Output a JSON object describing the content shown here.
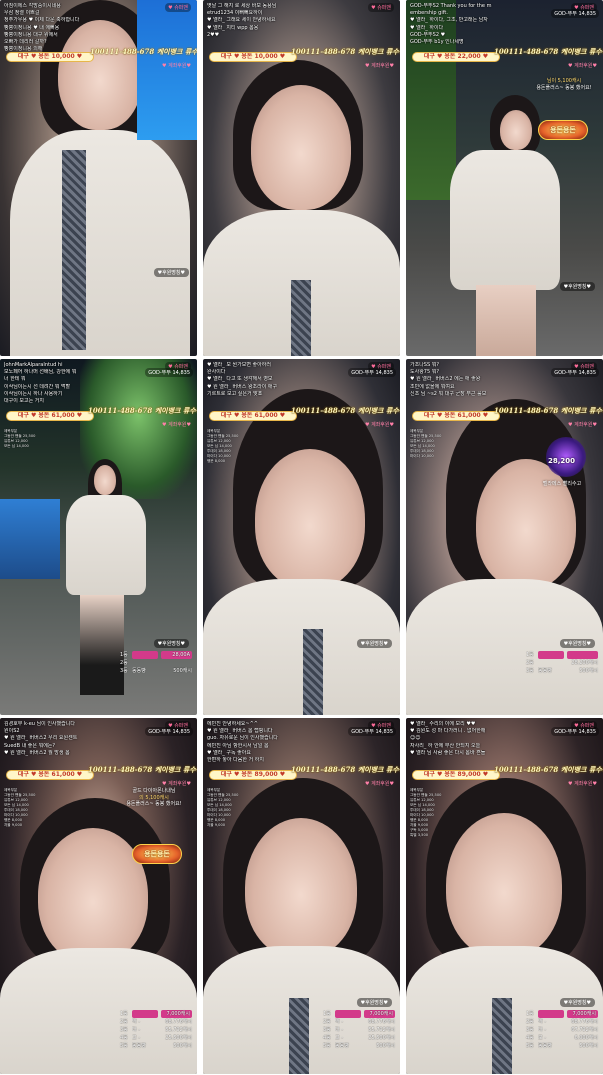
{
  "common": {
    "heart_badge": "♥ 슈퍼맨",
    "god_badge": "GOD-뚜뚜 14,835",
    "account_text": "100111-488-678 케이뱅크 류수욱",
    "rank_tag": "♥ 계좌후원♥",
    "sub_badge": "♥후원명칭♥",
    "mini_list": [
      "제목부분",
      "그동안 팬들 25,500",
      "유튜브 12,000",
      "모든 님 14,000",
      "투데이 18,000",
      "마이다 10,000",
      "행운 8,000",
      "자율 9,000",
      "구독 5,000",
      "특별 3,500",
      "기념 3,000",
      "랭킹 2,500"
    ]
  },
  "tiles": [
    {
      "goal": "대구 ♥ 용돈 10,000 ♥",
      "chat": [
        {
          "nick": "",
          "text": "아침이에스 각방중이시네용"
        },
        {
          "nick": "",
          "text": "우삼 정렬 이쁘걸"
        },
        {
          "nick": "",
          "text": "정주가우용 ♥ 이제 다운 축하합니다"
        },
        {
          "nick": "",
          "text": "빵뿡이정니용 ♥ 내 에뻐용"
        },
        {
          "nick": "",
          "text": "빵뿡이정니용 대구 위에서"
        },
        {
          "nick": "",
          "text": "오빠가 데리러 갈까?"
        },
        {
          "nick": "",
          "text": "빵뿡이정니용 의해"
        }
      ]
    },
    {
      "goal": "대구 ♥ 용돈 10,000 ♥",
      "chat": [
        {
          "nick": "",
          "text": "옛날 그 해지 로 세상 바보 동용님"
        },
        {
          "nick": "",
          "text": "etrud1234 이뻐뻐요하이"
        },
        {
          "nick": "",
          "text": "♥ 엘라_ 그래요 세이 안녕하세요"
        },
        {
          "nick": "",
          "text": "♥ 엘라_ 지티 wpp 봄용"
        },
        {
          "nick": "",
          "text": "2♥♥"
        }
      ]
    },
    {
      "goal": "대구 ♥ 용돈 22,000 ♥",
      "chat": [
        {
          "nick": "",
          "text": "GOD-뚜뚜S2 Thank you for the m"
        },
        {
          "nick": "",
          "text": "embership gift."
        },
        {
          "nick": "",
          "text": "♥ 엘라_ 하이다, 그조, 반고래는 남자"
        },
        {
          "nick": "",
          "text": "♥ 엘라_ 하이다"
        },
        {
          "nick": "",
          "text": "GOD-뚜뚜S2 ♥"
        },
        {
          "nick": "",
          "text": "GOD-뚜뚜 b1y 인나세명"
        }
      ]
    },
    {
      "goal": "대구 ♥ 용돈 61,000 ♥",
      "chat": [
        {
          "nick": "",
          "text": "JohnMarkAlparaIntud hi"
        },
        {
          "nick": "",
          "text": "모노페어 하나머 선배님, 강한에 뭐"
        },
        {
          "nick": "",
          "text": "너 한테 뭐"
        },
        {
          "nick": "",
          "text": "이삭님이는시 선 데려간 뭐 먹할"
        },
        {
          "nick": "",
          "text": "이삭님이는시 하나 사용하기"
        },
        {
          "nick": "",
          "text": "대구이 보고는 거지"
        }
      ]
    },
    {
      "goal": "대구 ♥ 용돈 61,000 ♥",
      "chat": [
        {
          "nick": "",
          "text": "♥ 엘라_ 모 뭔가보면 좋아하러"
        },
        {
          "nick": "",
          "text": "완사이다"
        },
        {
          "nick": "",
          "text": "♥ 엘라_ 다고 또 생각해서 영모"
        },
        {
          "nick": "",
          "text": "♥ 원 엘라_ 버버스 왕조라이 애구"
        },
        {
          "nick": "",
          "text": "기르트로 보고 싶은거 맞죠"
        }
      ]
    },
    {
      "goal": "대구 ♥ 용돈 61,000 ♥",
      "chat": [
        {
          "nick": "",
          "text": "가조나SS 뭐?"
        },
        {
          "nick": "",
          "text": "도사왕75 뭐?"
        },
        {
          "nick": "",
          "text": "♥ 원 엘라_ 버버스2 에는 애 좋왕"
        },
        {
          "nick": "",
          "text": "조민에 없을에 뭐여요"
        },
        {
          "nick": "",
          "text": "신조 님 ~s2 뭐 대구 군장 부근 룰보"
        }
      ]
    },
    {
      "goal": "대구 ♥ 용돈 61,000 ♥",
      "chat": [
        {
          "nick": "",
          "text": "김경호무 k-eu 님이 인사했습니다"
        },
        {
          "nick": "",
          "text": "원이S2"
        },
        {
          "nick": "",
          "text": "♥ 원 엘라_ 버버스2 우리 요원센트"
        },
        {
          "nick": "",
          "text": "SuedB 내 좋은 뭐에는?"
        },
        {
          "nick": "",
          "text": "♥ 원 엘라_ 버버스2 월 방생 봄"
        }
      ]
    },
    {
      "goal": "대구 ♥ 용돈 89,000 ♥",
      "chat": [
        {
          "nick": "",
          "text": "에빈진 안녕하세요~^^"
        },
        {
          "nick": "",
          "text": "♥ 원 엘라_ 버버스 봄 랩핑니다"
        },
        {
          "nick": "",
          "text": "guo. 자유로운 님이 인사했습니다"
        },
        {
          "nick": "",
          "text": "에빈진 아님 항한시서 남일 봄"
        },
        {
          "nick": "",
          "text": "♥ 엘라_ 구독 좋아요"
        },
        {
          "nick": "",
          "text": "한편하 놓아 다음한 거 하지"
        }
      ]
    },
    {
      "goal": "대구 ♥ 용돈 89,000 ♥",
      "chat": [
        {
          "nick": "",
          "text": "♥ 엘라_ 수리의 이에 보리 ♥♥"
        },
        {
          "nick": "",
          "text": "♥ 김원도 성 마 다가러니 . 없어한해"
        },
        {
          "nick": "",
          "text": "☺☺"
        },
        {
          "nick": "",
          "text": "자사리_ 하 안에 부산 안되지 오늘"
        },
        {
          "nick": "",
          "text": "♥ 엘라 님 사람 좋은 다시 봄바 흔들"
        }
      ]
    }
  ],
  "rankings_a": [
    {
      "pos": "1등",
      "name": "",
      "val": "28,00A"
    },
    {
      "pos": "2등",
      "name": "",
      "val": ""
    },
    {
      "pos": "3등",
      "name": "동동빵",
      "val": "500캐시"
    }
  ],
  "rankings_b": [
    {
      "pos": "1등",
      "name": "",
      "val": ""
    },
    {
      "pos": "2등",
      "name": "",
      "val": "28,200캐시"
    },
    {
      "pos": "3등",
      "name": "동동빵",
      "val": "500캐시"
    }
  ],
  "rankings_c": [
    {
      "pos": "1등",
      "name": "",
      "val": "7,000캐시"
    },
    {
      "pos": "2등",
      "name": "딱 -",
      "val": "68,776캐시"
    },
    {
      "pos": "3등",
      "name": "다 -",
      "val": "55,792캐시"
    },
    {
      "pos": "4등",
      "name": "고 -",
      "val": "25,500캐시"
    },
    {
      "pos": "5등",
      "name": "동동빵",
      "val": "500캐시"
    }
  ],
  "rankings_d": [
    {
      "pos": "1등",
      "name": "",
      "val": "7,000캐시"
    },
    {
      "pos": "2등",
      "name": "딱 -",
      "val": "68,776캐시"
    },
    {
      "pos": "3등",
      "name": "다 -",
      "val": "55,792캐시"
    },
    {
      "pos": "4등",
      "name": "고 -",
      "val": "25,500캐시"
    },
    {
      "pos": "5등",
      "name": "동동빵",
      "val": "500캐시"
    }
  ],
  "rankings_e": [
    {
      "pos": "1등",
      "name": "",
      "val": "7,000캐시"
    },
    {
      "pos": "2등",
      "name": "딱 -",
      "val": "68,776캐시"
    },
    {
      "pos": "3등",
      "name": "다 -",
      "val": "67,792캐시"
    },
    {
      "pos": "4등",
      "name": "모 -",
      "val": "6,000캐시"
    },
    {
      "pos": "5등",
      "name": "동동빵",
      "val": "500캐시"
    }
  ],
  "donation_popups": {
    "tile2": {
      "line1": "",
      "line2": "님이 5,100캐시",
      "line3": "용돈플러스~ 동봉 했어요!",
      "emblem": "용돈용돈"
    },
    "tile6": {
      "line1": "골드 다이아몬나내님",
      "line2": "의 5,100캐시",
      "line3": "용돈플러스~ 동봉 했어요!",
      "emblem": "용돈용돈"
    }
  },
  "live_glow_count": "28,200",
  "live_glow_label": "벨라메스 빨리수고"
}
